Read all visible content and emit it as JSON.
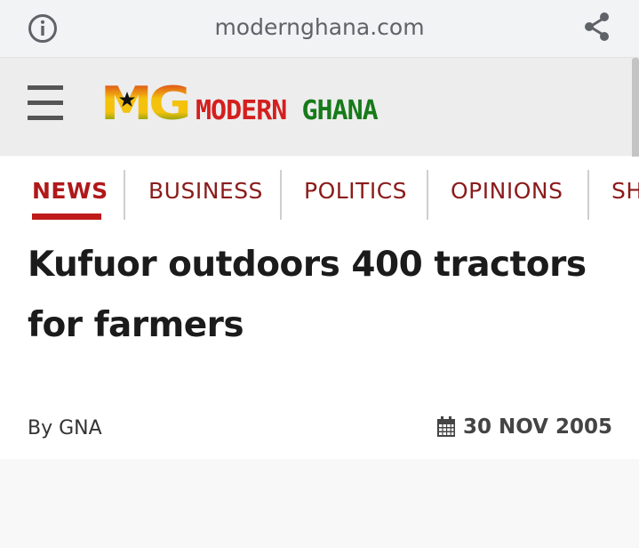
{
  "browser": {
    "url": "modernghana.com"
  },
  "site": {
    "logo_mark": "MG",
    "logo_word1": "MODERN",
    "logo_word2": "GHANA",
    "colors": {
      "red": "#d41f1f",
      "green": "#177a1a",
      "gold": "#f4c20d"
    }
  },
  "nav": {
    "items": [
      {
        "label": "NEWS",
        "active": true
      },
      {
        "label": "BUSINESS"
      },
      {
        "label": "POLITICS"
      },
      {
        "label": "OPINIONS"
      },
      {
        "label": "SH"
      }
    ]
  },
  "article": {
    "headline": "Kufuor outdoors 400 tractors for farmers",
    "byline": "By GNA",
    "date": "30 NOV 2005"
  }
}
